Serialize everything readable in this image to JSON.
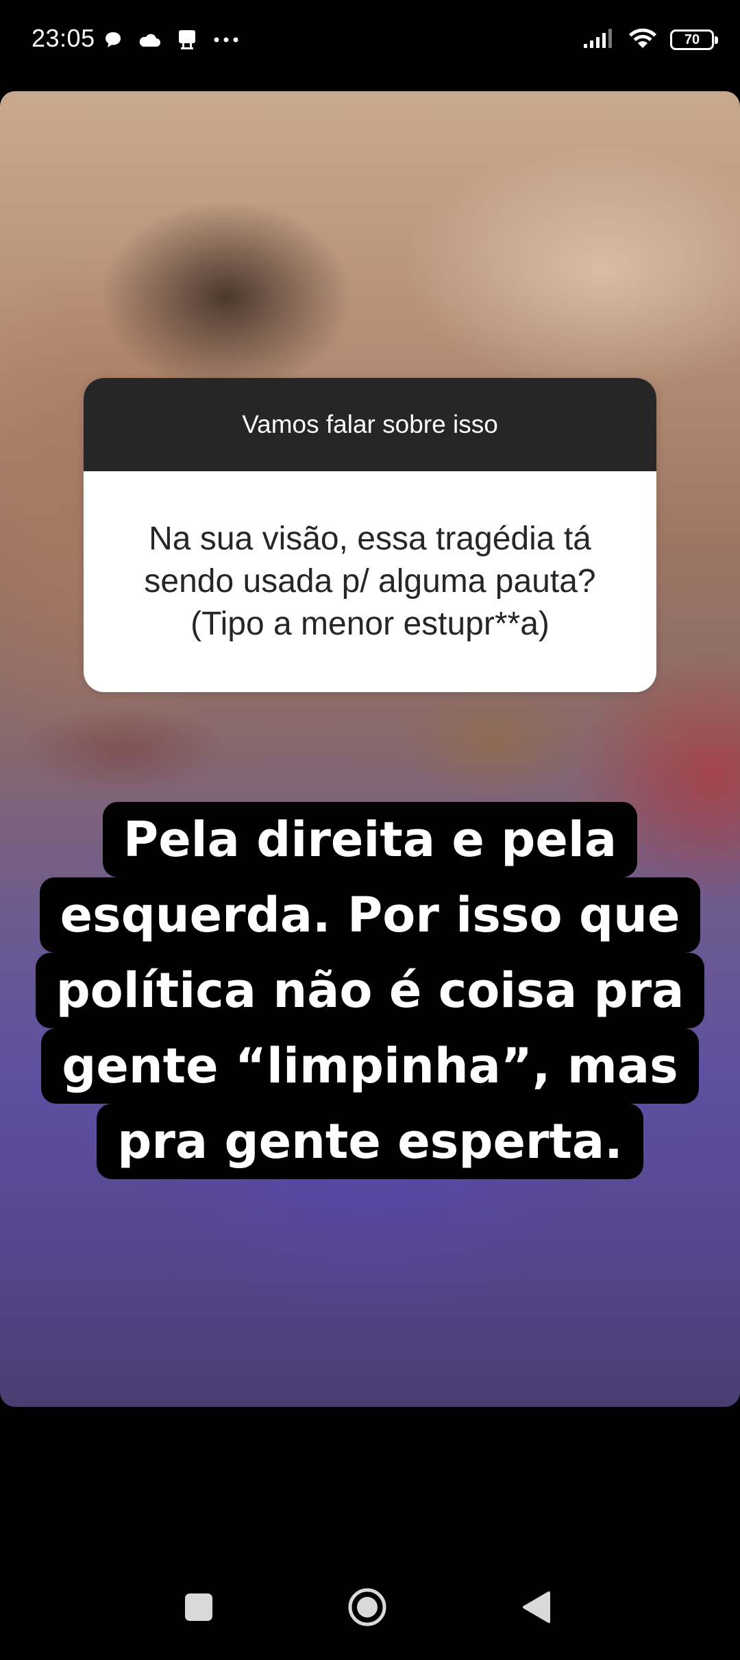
{
  "status_bar": {
    "time": "23:05",
    "left_icons": [
      "chat-bubble-icon",
      "cloud-icon",
      "notification-icon",
      "more-dots-icon"
    ],
    "right_icons": [
      "signal-icon",
      "wifi-icon",
      "battery-icon"
    ],
    "battery_level": "70"
  },
  "story": {
    "question_sticker": {
      "prompt": "Vamos falar sobre isso",
      "question": "Na sua visão, essa tragédia tá\nsendo usada p/ alguma pauta?\n(Tipo a menor estupr**a)"
    },
    "answer_lines": [
      "Pela direita e pela",
      "esquerda. Por isso que",
      "política não é coisa pra",
      "gente “limpinha”, mas",
      "pra gente esperta."
    ]
  },
  "navigation": {
    "buttons": [
      "recents-button",
      "home-button",
      "back-button"
    ]
  }
}
